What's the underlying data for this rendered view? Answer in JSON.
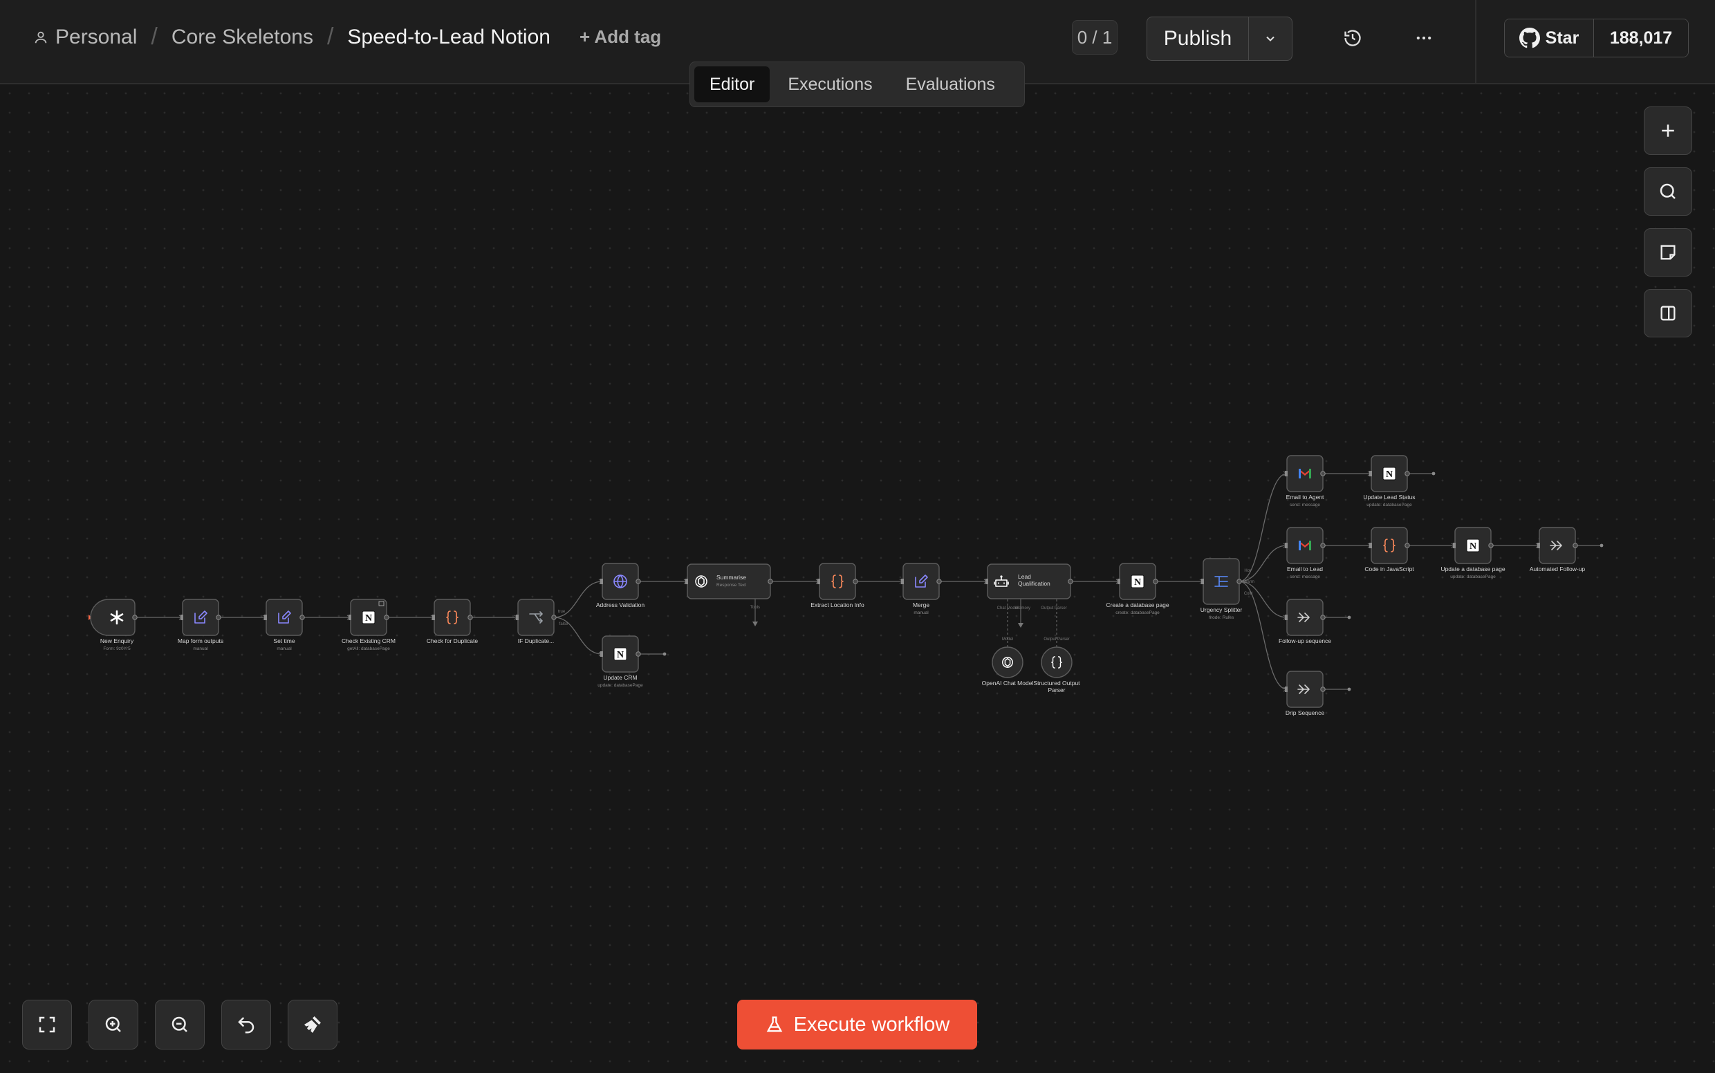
{
  "header": {
    "breadcrumb": [
      "Personal",
      "Core Skeletons",
      "Speed-to-Lead Notion"
    ],
    "add_tag": "+ Add tag",
    "counter": "0 / 1",
    "publish_label": "Publish",
    "github_star": "Star",
    "github_count": "188,017"
  },
  "tabs": [
    {
      "label": "Editor",
      "active": true
    },
    {
      "label": "Executions",
      "active": false
    },
    {
      "label": "Evaluations",
      "active": false
    }
  ],
  "toolbar": {
    "right": [
      "plus-icon",
      "search-icon",
      "sticky-note-icon",
      "panel-icon"
    ],
    "bottom": [
      "fit-view-icon",
      "zoom-in-icon",
      "zoom-out-icon",
      "undo-icon",
      "clean-up-icon"
    ],
    "execute_label": "Execute workflow"
  },
  "nodes": [
    {
      "id": "new-enquiry",
      "label": "New Enquiry",
      "sub": "Form: 9z0Yr5",
      "icon": "asterisk",
      "color": "#ffffff"
    },
    {
      "id": "map-form",
      "label": "Map form outputs",
      "sub": "manual",
      "icon": "pencil",
      "color": "#8a88ff"
    },
    {
      "id": "set-time",
      "label": "Set time",
      "sub": "manual",
      "icon": "pencil",
      "color": "#8a88ff"
    },
    {
      "id": "check-crm",
      "label": "Check Existing CRM",
      "sub": "getAll: databasePage",
      "icon": "notion",
      "color": "#ffffff"
    },
    {
      "id": "check-dup",
      "label": "Check for Duplicate",
      "sub": "",
      "icon": "braces",
      "color": "#ff8a5b"
    },
    {
      "id": "if-dup",
      "label": "IF Duplicate...",
      "sub": "",
      "icon": "branch",
      "color": "#9aa0a6"
    },
    {
      "id": "addr",
      "label": "Address Validation",
      "sub": "",
      "icon": "globe",
      "color": "#8a88ff"
    },
    {
      "id": "update-crm",
      "label": "Update CRM",
      "sub": "update: databasePage",
      "icon": "notion",
      "color": "#ffffff"
    },
    {
      "id": "summarise",
      "label": "Summarise",
      "sub": "Response Text",
      "icon": "openai",
      "color": "#ffffff"
    },
    {
      "id": "extract",
      "label": "Extract Location Info",
      "sub": "",
      "icon": "braces",
      "color": "#ff8a5b"
    },
    {
      "id": "merge",
      "label": "Merge",
      "sub": "manual",
      "icon": "pencil",
      "color": "#8a88ff"
    },
    {
      "id": "lead-qual",
      "label": "Lead Qualification",
      "sub": "",
      "icon": "robot",
      "color": "#ffffff"
    },
    {
      "id": "openai-model",
      "label": "OpenAI Chat Model",
      "sub": "",
      "icon": "openai",
      "color": "#ffffff"
    },
    {
      "id": "parser",
      "label": "Structured Output Parser",
      "sub": "",
      "icon": "braces",
      "color": "#ffffff"
    },
    {
      "id": "create-db",
      "label": "Create a database page",
      "sub": "create: databasePage",
      "icon": "notion",
      "color": "#ffffff"
    },
    {
      "id": "urgency",
      "label": "Urgency Splitter",
      "sub": "mode: Rules",
      "icon": "switch",
      "color": "#5a8cff"
    },
    {
      "id": "email-agent",
      "label": "Email to Agent",
      "sub": "send: message",
      "icon": "gmail",
      "color": "#ea4335"
    },
    {
      "id": "update-status",
      "label": "Update Lead Status",
      "sub": "update: databasePage",
      "icon": "notion",
      "color": "#ffffff"
    },
    {
      "id": "email-lead",
      "label": "Email to Lead",
      "sub": "send: message",
      "icon": "gmail",
      "color": "#ea4335"
    },
    {
      "id": "code-js",
      "label": "Code in JavaScript",
      "sub": "",
      "icon": "braces",
      "color": "#ff8a5b"
    },
    {
      "id": "update-db",
      "label": "Update a database page",
      "sub": "update: databasePage",
      "icon": "notion",
      "color": "#ffffff"
    },
    {
      "id": "auto-follow",
      "label": "Automated Follow-up",
      "sub": "",
      "icon": "chevrons",
      "color": "#cfcfcf"
    },
    {
      "id": "follow-seq",
      "label": "Follow-up sequence",
      "sub": "",
      "icon": "chevrons",
      "color": "#cfcfcf"
    },
    {
      "id": "drip",
      "label": "Drip Sequence",
      "sub": "",
      "icon": "chevrons",
      "color": "#cfcfcf"
    }
  ],
  "port_labels": {
    "if_true": "true",
    "if_false": "false",
    "summarise_tools": "Tools",
    "lq_chat_model": "Chat Model",
    "lq_memory": "Memory",
    "lq_output_parser": "Output Parser",
    "model": "Model",
    "output_parser": "Output Parser",
    "urgency_hot": "Hot",
    "urgency_warm": "Warm",
    "urgency_cold": "Cold"
  }
}
